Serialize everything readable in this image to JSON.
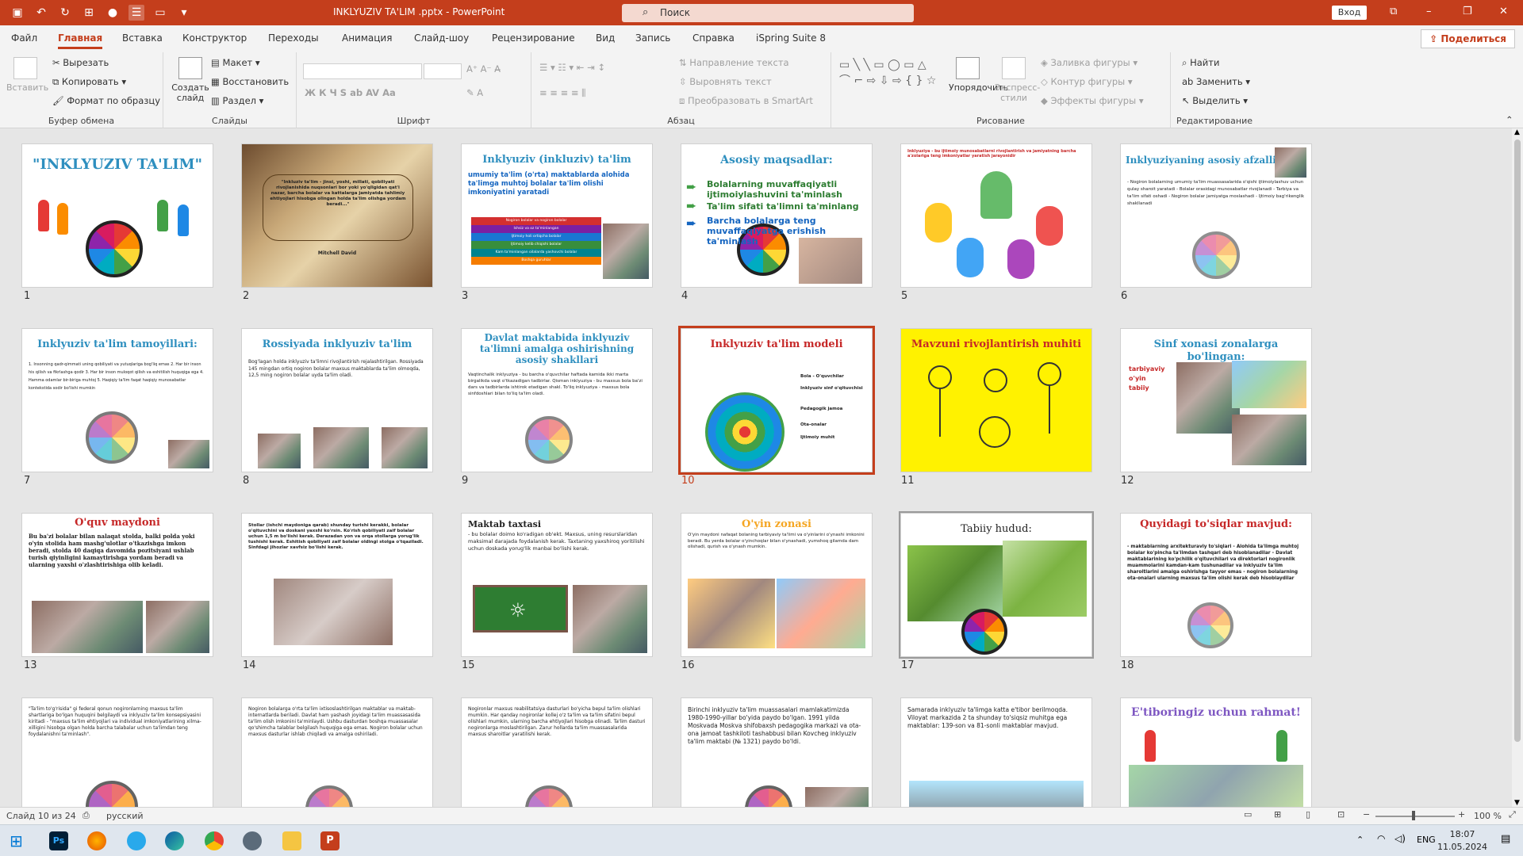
{
  "titlebar": {
    "title": "INKLYUZIV TA'LIM .pptx  -  PowerPoint",
    "search_placeholder": "Поиск",
    "signin": "Вход",
    "minimize": "–",
    "restore": "❐",
    "close": "✕"
  },
  "tabs": [
    "Файл",
    "Главная",
    "Вставка",
    "Конструктор",
    "Переходы",
    "Анимация",
    "Слайд-шоу",
    "Рецензирование",
    "Вид",
    "Запись",
    "Справка",
    "iSpring Suite 8"
  ],
  "share": "Поделиться",
  "ribbon": {
    "clipboard": {
      "group": "Буфер обмена",
      "paste": "Вставить",
      "cut": "Вырезать",
      "copy": "Копировать",
      "format": "Формат по образцу"
    },
    "slides": {
      "group": "Слайды",
      "new": "Создать слайд",
      "layout": "Макет",
      "reset": "Восстановить",
      "section": "Раздел"
    },
    "font": {
      "group": "Шрифт"
    },
    "paragraph": {
      "group": "Абзац",
      "direction": "Направление текста",
      "align": "Выровнять текст",
      "smartart": "Преобразовать в SmartArt"
    },
    "drawing": {
      "group": "Рисование",
      "arrange": "Упорядочить",
      "styles": "Экспресс-стили",
      "fill": "Заливка фигуры",
      "outline": "Контур фигуры",
      "effects": "Эффекты фигуры"
    },
    "editing": {
      "group": "Редактирование",
      "find": "Найти",
      "replace": "Заменить",
      "select": "Выделить"
    }
  },
  "slides": [
    {
      "n": "1",
      "title": "\"INKLYUZIV TA'LIM\""
    },
    {
      "n": "2",
      "title": "",
      "quote": "\"Inkluziv ta'lim - jinsi, yoshi, millati, qobiliyati rivojlanishida nuqsonlari bor yoki yo'qligidan qat'i nazar, barcha bolalar va kattalarga jamiyatda tahlimiy ehtiyojlari hisobga olingan holda ta'lim olishga yordam beradi...\"",
      "author": "Mitchell David"
    },
    {
      "n": "3",
      "title": "Inklyuziv (inkluziv) ta'lim",
      "body": "umumiy ta'lim (o'rta) maktablarda alohida ta'limga muhtoj bolalar ta'lim olishi imkoniyatini yaratadi",
      "bars": [
        "Nogiron bolalar va nogiron bolalar",
        "Ishsiz va oz ta'minlangan",
        "Ijtimoiy holi ortiqcha bolalar",
        "Ijtimoiy kelib chiqishi bolalar",
        "Kam ta'minlangan oilalarda yashovchi bolalar",
        "Boshqa guruhlar"
      ]
    },
    {
      "n": "4",
      "title": "Asosiy maqsadlar:",
      "items": [
        "Bolalarning muvaffaqiyatli ijtimoiylashuvini ta'minlash",
        "Ta'lim sifati ta'limni ta'minlang",
        "Barcha bolalarga teng muvaffaqiyatga erishish ta'minlash"
      ]
    },
    {
      "n": "5",
      "title": "Inklyuziya - bu ijtimoiy munosabatlarni rivojlantirish va jamiyatning barcha a'zolariga teng imkoniyatlar yaratish jarayonidir"
    },
    {
      "n": "6",
      "title": "Inklyuziyaning asosiy afzalliklari",
      "body": "- Nogiron bolalarning umumiy ta'lim muassasalarida o'qishi ijtimoiylashuv uchun qulay sharoit yaratadi - Bolalar orasidagi munosabatlar rivojlanadi - Tarbiya va ta'lim sifati oshadi - Nogiron bolalar jamiyatga moslashadi - Ijtimoiy bag'rikenglik shakllanadi"
    },
    {
      "n": "7",
      "title": "Inklyuziv ta'lim tamoyillari:",
      "body": "1. Insonning qadr-qimmati uning qobiliyati va yutuqlariga bog'liq emas 2. Har bir inson his qilish va fikrlashga qodir 3. Har bir inson muloqot qilish va eshitilish huquqiga ega 4. Hamma odamlar bir-biriga muhtoj 5. Haqiqiy ta'lim faqat haqiqiy munosabatlar kontekstida sodir bo'lishi mumkin"
    },
    {
      "n": "8",
      "title": "Rossiyada inklyuziv ta'lim",
      "body": "Bog'lagan holda inklyuziv ta'limni rivojlantirish rejalashtirilgan. Rossiyada 145 mingdan ortiq nogiron bolalar maxsus maktablarda ta'lim olmoqda, 12,5 ming nogiron bolalar uyda ta'lim oladi."
    },
    {
      "n": "9",
      "title": "Davlat maktabida inklyuziv ta'limni amalga oshirishning asosiy shakllari",
      "body": "Vaqtinchalik inklyuziya - bu barcha o'quvchilar haftada kamida ikki marta birgalikda vaqt o'tkazadigan tadbirlar. Qisman inklyuziya - bu maxsus bola ba'zi dars va tadbirlarda ishtirok etadigan shakl. To'liq inklyuziya - maxsus bola sinfdoshlari bilan to'liq ta'lim oladi."
    },
    {
      "n": "10",
      "title": "Inklyuziv ta'lim modeli",
      "labels": [
        "Bola - O'quvchilar",
        "Inklyuziv sinf o'qituvchisi",
        "Pedagogik jamoa",
        "Ota-onalar",
        "Ijtimoiy muhit"
      ]
    },
    {
      "n": "11",
      "title": "Mavzuni rivojlantirish muhiti"
    },
    {
      "n": "12",
      "title": "Sinf xonasi zonalarga bo'lingan:",
      "items": [
        "tarbiyaviy",
        "o'yin",
        "tabiiy"
      ]
    },
    {
      "n": "13",
      "title": "O'quv maydoni",
      "body": "Bu ba'zi bolalar bilan nalaqat stolda, balki polda yoki o'yin stolida ham mashg'ulotlar o'tkazishga imkon beradi, stolda 40 daqiqa davomida pozitsiyani ushlab turish qiyinligini kamaytirishga yordam beradi va ularning yaxshi o'zlashtirishiga olib keladi."
    },
    {
      "n": "14",
      "title": "",
      "body": "Stollar (ishchi maydoniga qarab) shunday turishi kerakki, bolalar o'qituvchini va doskani yaxshi ko'rsin. Ko'rish qobiliyati zaif bolalar uchun 1,5 m bo'lishi kerak. Derazadan yon va orqa stollarga yorug'lik tushishi kerak. Eshitish qobiliyati zaif bolalar oldingi stolga o'tqaziladi. Sinfdagi jihozlar xavfsiz bo'lishi kerak."
    },
    {
      "n": "15",
      "title": "Maktab taxtasi",
      "body": "- bu bolalar doimo ko'radigan ob'ekt. Maxsus, uning resurslaridan maksimal darajada foydalanish kerak. Taxtaning yaxshiroq yoritilishi uchun doskada yorug'lik manbai bo'lishi kerak."
    },
    {
      "n": "16",
      "title": "O'yin zonasi",
      "body": "O'yin maydoni nafaqat bolaning tarbiyaviy ta'limi va o'yinlarini o'ynashi imkonini beradi. Bu yerda bolalar o'yinchoqlar bilan o'ynashadi, yumshoq gilamda dam olishadi, qurish va o'ynash mumkin."
    },
    {
      "n": "17",
      "title": "Tabiiy hudud:"
    },
    {
      "n": "18",
      "title": "Quyidagi to'siqlar mavjud:",
      "body": "- maktablarning arxitekturaviy to'siqlari - Alohida ta'limga muhtoj bolalar ko'pincha ta'limdan tashqari deb hisoblanadilar - Davlat maktablarining ko'pchilik o'qituvchilari va direktorlari nogironlik muammolarini kamdan-kam tushunadilar va inklyuziv ta'lim sharoitlarini amalga oshirishga tayyor emas - nogiron bolalarning ota-onalari ularning maxsus ta'lim olishi kerak deb hisoblaydilar"
    },
    {
      "n": "19",
      "title": "",
      "body": "\"Ta'lim to'g'risida\" gi federal qonun nogironlarning maxsus ta'lim shartlariga bo'lgan huquqini belgilaydi va inklyuziv ta'lim konsepsiyasini kiritadi - \"maxsus ta'lim ehtiyojlari va individual imkoniyatlarining xilma-xilligini hisobga olgan holda barcha talabalar uchun ta'limdan teng foydalanishni ta'minlash\"."
    },
    {
      "n": "20",
      "title": "",
      "body": "Nogiron bolalarga o'rta ta'lim ixtisoslashtirilgan maktablar va maktab-internatlarda beriladi. Davlat ham yashash joyidagi ta'lim muassasasida ta'lim olish imkonini ta'minlaydi. Ushbu dasturdan boshqa muassasalar qo'shimcha talablar belgilash huquqiga ega emas. Nogiron bolalar uchun maxsus dasturlar ishlab chiqiladi va amalga oshiriladi."
    },
    {
      "n": "21",
      "title": "",
      "body": "Nogironlar maxsus reabilitatsiya dasturlari bo'yicha bepul ta'lim olishlari mumkin. Har qanday nogironlar kollej o'z ta'lim va ta'lim sifatini bepul olishlari mumkin, ularning barcha ehtiyojlari hisobga olinadi. Ta'lim dasturi nogironlarga moslashtirilgan. Zarur hollarda ta'lim muassasalarida maxsus sharoitlar yaratilishi kerak."
    },
    {
      "n": "22",
      "title": "",
      "body": "Birinchi inklyuziv ta'lim muassasalari mamlakatimizda 1980-1990-yillar bo'yida paydo bo'lgan. 1991 yilda Moskvada Moskva shifobaxsh pedagogika markazi va ota-ona jamoat tashkiloti tashabbusi bilan Kovcheg inklyuziv ta'lim maktabi (№ 1321) paydo bo'ldi."
    },
    {
      "n": "23",
      "title": "",
      "body": "Samarada inklyuziv ta'limga katta e'tibor berilmoqda. Viloyat markazida 2 ta shunday to'siqsiz muhitga ega maktablar: 139-son va 81-sonli maktablar mavjud."
    },
    {
      "n": "24",
      "title": "E'tiboringiz uchun rahmat!"
    }
  ],
  "status": {
    "slide": "Слайд 10 из 24",
    "lang": "русский",
    "zoom": "100 %"
  },
  "taskbar": {
    "lang": "ENG",
    "time": "18:07",
    "date": "11.05.2024"
  }
}
